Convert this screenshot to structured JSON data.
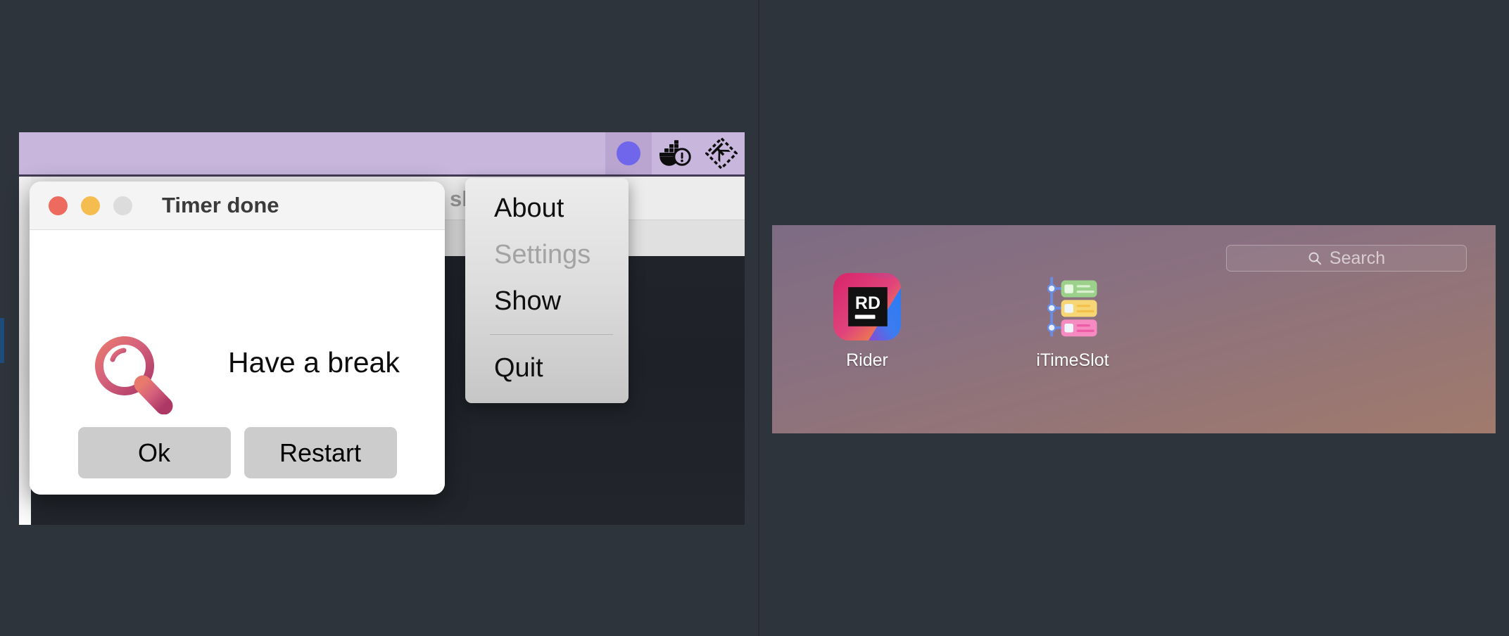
{
  "menubar": {
    "icons": [
      {
        "name": "app-status-dot",
        "title": "Timer app menubar icon",
        "active": true
      },
      {
        "name": "docker-icon",
        "title": "Docker",
        "active": false
      },
      {
        "name": "kubernetes-k-icon",
        "title": "Kubernetes",
        "active": false
      }
    ]
  },
  "background_window": {
    "title_fragment": "sh"
  },
  "dialog": {
    "title": "Timer done",
    "message": "Have a break",
    "icon": "magnifier-icon",
    "traffic_lights": {
      "close": "close-button",
      "minimize": "minimize-button",
      "zoom": "zoom-button"
    },
    "buttons": [
      {
        "label": "Ok",
        "name": "ok-button"
      },
      {
        "label": "Restart",
        "name": "restart-button"
      }
    ]
  },
  "dropdown_menu": {
    "items": [
      {
        "label": "About",
        "name": "menu-item-about",
        "disabled": false
      },
      {
        "label": "Settings",
        "name": "menu-item-settings",
        "disabled": true
      },
      {
        "label": "Show",
        "name": "menu-item-show",
        "disabled": false
      },
      {
        "label": "Quit",
        "name": "menu-item-quit",
        "disabled": false
      }
    ]
  },
  "launchpad": {
    "search": {
      "placeholder": "Search",
      "value": ""
    },
    "apps": [
      {
        "label": "Rider",
        "name": "app-icon-rider",
        "icon": "rider-icon"
      },
      {
        "label": "iTimeSlot",
        "name": "app-icon-itimeslot",
        "icon": "itimeslot-icon"
      }
    ]
  },
  "colors": {
    "desktop": "#2e343b",
    "menubar": "#c8b6dd",
    "menubar_active": "#b9a5d0",
    "accent_dot": "#6f66ec",
    "dialog_bg": "#ffffff",
    "button_bg": "#cccccc",
    "launchpad_gradient_start": "#7d6b84",
    "launchpad_gradient_end": "#a07a6c",
    "traffic_close": "#ed6a5e",
    "traffic_min": "#f5bd4f",
    "traffic_zoom": "#dcdcdc"
  }
}
